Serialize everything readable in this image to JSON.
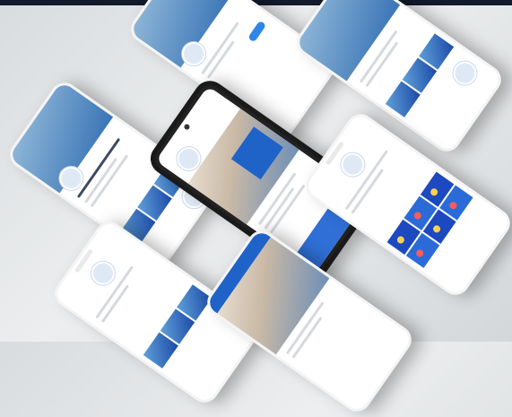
{
  "scene": {
    "kind": "app-screen-mockup",
    "colors": {
      "background": "#e3e6e9",
      "accent_blue": "#1f63c9",
      "button_blue": "#2f86e6",
      "phone_frame_dark": "#1a1a1a"
    }
  },
  "phones": [
    {
      "name": "phone-top-left",
      "style": "light"
    },
    {
      "name": "phone-top-center",
      "style": "light"
    },
    {
      "name": "phone-top-right",
      "style": "light"
    },
    {
      "name": "phone-left",
      "style": "light"
    },
    {
      "name": "phone-center",
      "style": "dark"
    },
    {
      "name": "phone-right",
      "style": "light"
    },
    {
      "name": "phone-bottom-left",
      "style": "light"
    },
    {
      "name": "phone-bottom-center",
      "style": "light"
    }
  ]
}
